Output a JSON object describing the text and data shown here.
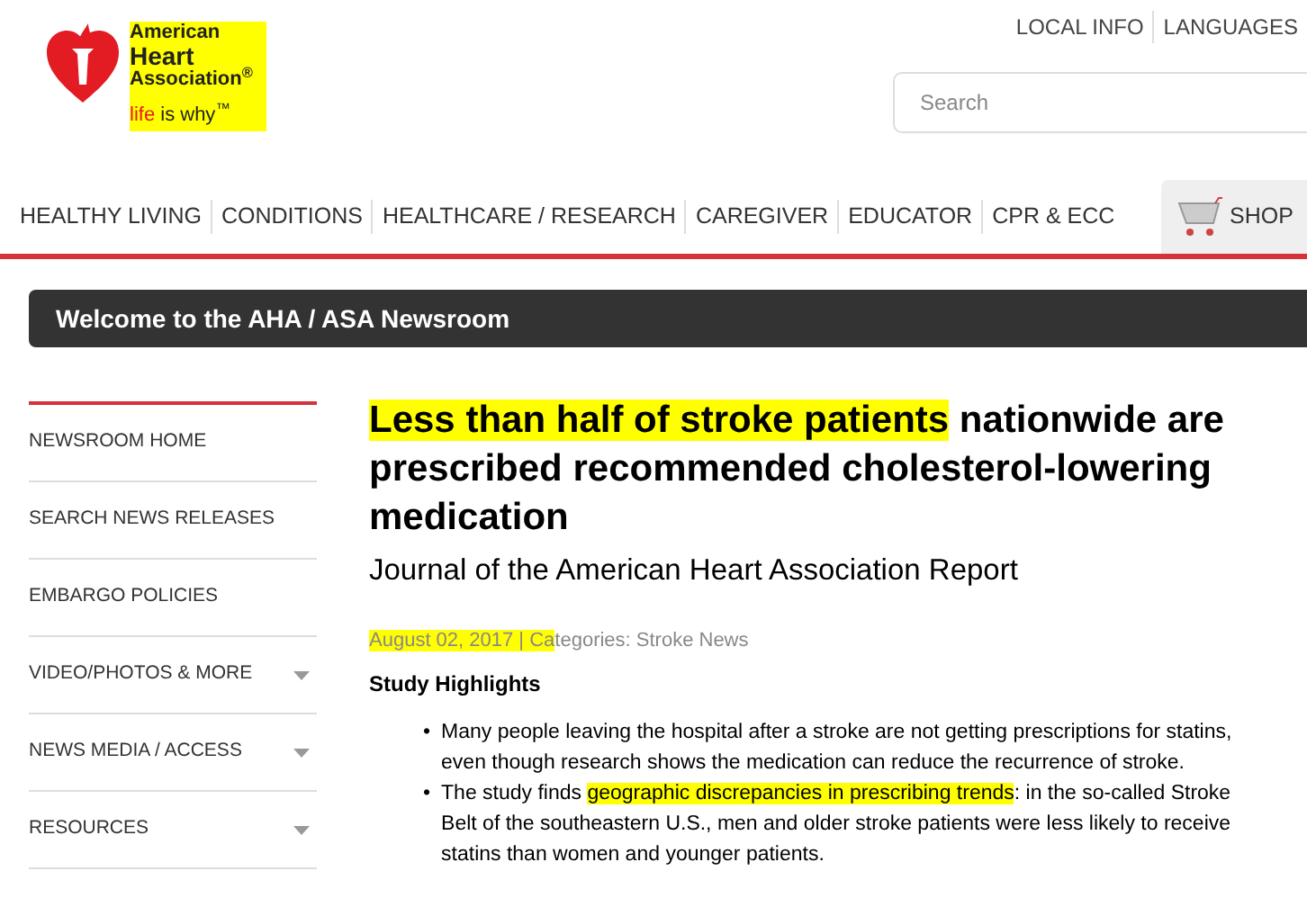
{
  "logo": {
    "lines": [
      "American",
      "Heart",
      "Association$^{®}$"
    ],
    "tagline_red": "life",
    "tagline_rest": "is why$^{™}$",
    "highlighted": true
  },
  "utility_links": [
    "LOCAL INFO",
    "LANGUAGES"
  ],
  "search": {
    "placeholder": "Search"
  },
  "nav": [
    "HEALTHY LIVING",
    "CONDITIONS",
    "HEALTHCARE / RESEARCH",
    "CAREGIVER",
    "EDUCATOR",
    "CPR & ECC"
  ],
  "shop": {
    "label": "SHOP"
  },
  "banner": "Welcome to the AHA / ASA Newsroom",
  "sidebar": [
    {
      "label": "NEWSROOM HOME",
      "expandable": false
    },
    {
      "label": "SEARCH NEWS RELEASES",
      "expandable": false
    },
    {
      "label": "EMBARGO POLICIES",
      "expandable": false
    },
    {
      "label": "VIDEO/PHOTOS & MORE",
      "expandable": true
    },
    {
      "label": "NEWS MEDIA / ACCESS",
      "expandable": true
    },
    {
      "label": "RESOURCES",
      "expandable": true
    }
  ],
  "article": {
    "headline": [
      {
        "text": "Less than half of stroke patients",
        "highlighted": true
      },
      {
        "text": " nationwide are prescribed recommended cholesterol-lowering medication",
        "highlighted": false
      }
    ],
    "subtitle": "Journal of the American Heart Association Report",
    "meta": [
      {
        "text": "August 02, 2017 | Ca",
        "highlighted": true
      },
      {
        "text": "tegories: Stroke News",
        "highlighted": false
      }
    ],
    "section_title": "Study Highlights",
    "bullets": [
      {
        "marker": "•",
        "segments": [
          {
            "text": "Many people leaving the hospital after a stroke are not getting prescriptions for statins, even though research shows the medication can reduce the recurrence of stroke.",
            "highlighted": false
          }
        ]
      },
      {
        "marker": "•",
        "segments": [
          {
            "text": "The study finds ",
            "highlighted": false
          },
          {
            "text": "geographic discrepancies in prescribing trends",
            "highlighted": true
          },
          {
            "text": ": in the so-called Stroke Belt of the southeastern U.S., men and older stroke patients were less likely to receive statins than women and younger patients.",
            "highlighted": false
          }
        ]
      }
    ]
  }
}
